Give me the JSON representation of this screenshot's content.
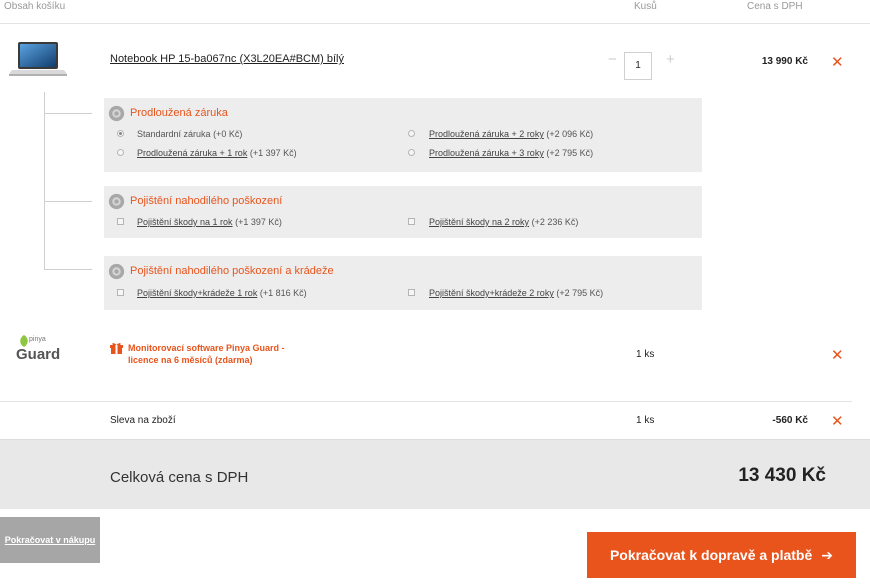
{
  "header": {
    "col_contents": "Obsah košíku",
    "col_qty": "Kusů",
    "col_price": "Cena s DPH"
  },
  "product": {
    "name": "Notebook HP 15-ba067nc (X3L20EA#BCM) bílý",
    "qty": "1",
    "minus": "−",
    "plus": "+",
    "price": "13 990 Kč",
    "remove": "✕"
  },
  "services": [
    {
      "title": "Prodloužená záruka",
      "options": [
        {
          "label": "Standardní záruka",
          "extra": "(+0 Kč)",
          "link": false,
          "checked": true
        },
        {
          "label": "Prodloužená záruka + 2 roky",
          "extra": "(+2 096 Kč)",
          "link": true,
          "checked": false
        },
        {
          "label": "Prodloužená záruka + 1 rok",
          "extra": "(+1 397 Kč)",
          "link": true,
          "checked": false
        },
        {
          "label": "Prodloužená záruka + 3 roky",
          "extra": "(+2 795 Kč)",
          "link": true,
          "checked": false
        }
      ]
    },
    {
      "title": "Pojištění nahodilého poškození",
      "options": [
        {
          "label": "Pojištění škody na 1 rok",
          "extra": "(+1 397 Kč)",
          "link": true,
          "checked": false
        },
        {
          "label": "Pojištění škody na 2 roky",
          "extra": "(+2 236 Kč)",
          "link": true,
          "checked": false
        }
      ]
    },
    {
      "title": "Pojištění nahodilého poškození a krádeže",
      "options": [
        {
          "label": "Pojištění škody+krádeže 1 rok",
          "extra": "(+1 816 Kč)",
          "link": true,
          "checked": false
        },
        {
          "label": "Pojištění škody+krádeže 2 roky",
          "extra": "(+2 795 Kč)",
          "link": true,
          "checked": false
        }
      ]
    }
  ],
  "gift": {
    "logo_small": "pinya",
    "logo_big": "Guard",
    "text_line1": "Monitorovací software Pinya Guard -",
    "text_line2": "licence na 6 měsíců (zdarma)",
    "qty": "1 ks",
    "remove": "✕"
  },
  "discount": {
    "label": "Sleva na zboží",
    "qty": "1 ks",
    "price": "-560 Kč",
    "remove": "✕"
  },
  "total": {
    "label": "Celková cena s DPH",
    "value": "13 430 Kč"
  },
  "buttons": {
    "back": "Pokračovat v nákupu",
    "next": "Pokračovat k dopravě a platbě",
    "next_arrow": "➔"
  },
  "colors": {
    "accent": "#e8541c",
    "service_bg": "#ededed",
    "total_bg": "#e8e8e8",
    "back_btn": "#a6a6a6"
  }
}
